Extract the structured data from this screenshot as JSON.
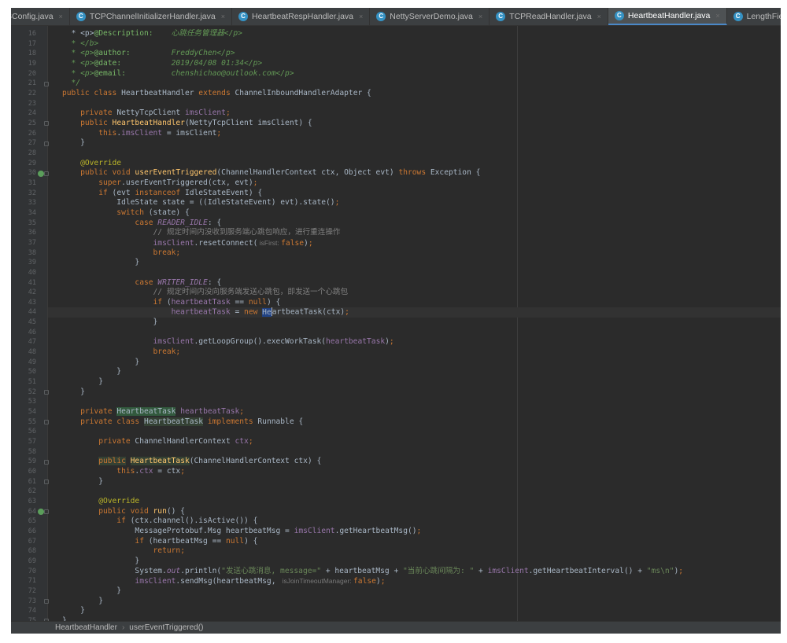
{
  "tabs": [
    {
      "label": "SConfig.java",
      "active": false,
      "icon": "none"
    },
    {
      "label": "TCPChannelInitializerHandler.java",
      "active": false,
      "icon": "class-icon"
    },
    {
      "label": "HeartbeatRespHandler.java",
      "active": false,
      "icon": "class-icon"
    },
    {
      "label": "NettyServerDemo.java",
      "active": false,
      "icon": "class-icon"
    },
    {
      "label": "TCPReadHandler.java",
      "active": false,
      "icon": "class-icon"
    },
    {
      "label": "HeartbeatHandler.java",
      "active": true,
      "icon": "class-icon"
    },
    {
      "label": "LengthFieldBasedFrameD",
      "active": false,
      "icon": "class-icon"
    }
  ],
  "class_icon_glyph": "C",
  "close_glyph": "×",
  "code_lines": [
    {
      "n": "16",
      "segs": [
        [
          "  ",
          ""
        ],
        [
          "* <p>",
          ""
        ],
        [
          "@Description:",
          "dt"
        ],
        [
          "    心跳任务管理器</p>",
          "cd"
        ]
      ],
      "cls": "cd"
    },
    {
      "n": "17",
      "segs": [
        [
          "  * </b>",
          "cd"
        ]
      ]
    },
    {
      "n": "18",
      "segs": [
        [
          "  * <p>",
          "cd"
        ],
        [
          "@author:",
          "dt"
        ],
        [
          "         FreddyChen</p>",
          "cd"
        ]
      ]
    },
    {
      "n": "19",
      "segs": [
        [
          "  * <p>",
          "cd"
        ],
        [
          "@date:",
          "dt"
        ],
        [
          "           2019/04/08 01:34</p>",
          "cd"
        ]
      ]
    },
    {
      "n": "20",
      "segs": [
        [
          "  * <p>",
          "cd"
        ],
        [
          "@email:",
          "dt"
        ],
        [
          "          chenshichao@outlook.com</p>",
          "cd"
        ]
      ]
    },
    {
      "n": "21",
      "segs": [
        [
          "  */",
          "cd"
        ]
      ]
    },
    {
      "n": "22",
      "segs": [
        [
          "public class ",
          "k"
        ],
        [
          "HeartbeatHandler ",
          ""
        ],
        [
          "extends ",
          "k"
        ],
        [
          "ChannelInboundHandlerAdapter {",
          ""
        ]
      ]
    },
    {
      "n": "23",
      "segs": []
    },
    {
      "n": "24",
      "segs": [
        [
          "    private ",
          "k"
        ],
        [
          "NettyTcpClient ",
          ""
        ],
        [
          "imsClient",
          "f"
        ],
        [
          ";",
          "k"
        ]
      ]
    },
    {
      "n": "25",
      "segs": [
        [
          "    public ",
          "k"
        ],
        [
          "HeartbeatHandler",
          "m"
        ],
        [
          "(NettyTcpClient imsClient) {",
          ""
        ]
      ]
    },
    {
      "n": "26",
      "segs": [
        [
          "        this",
          "k"
        ],
        [
          ".",
          ""
        ],
        [
          "imsClient",
          "f"
        ],
        [
          " = imsClient",
          ""
        ],
        [
          ";",
          "k"
        ]
      ]
    },
    {
      "n": "27",
      "segs": [
        [
          "    }",
          ""
        ]
      ]
    },
    {
      "n": "28",
      "segs": []
    },
    {
      "n": "29",
      "segs": [
        [
          "    @Override",
          "a"
        ]
      ]
    },
    {
      "n": "30",
      "segs": [
        [
          "    public void ",
          "k"
        ],
        [
          "userEventTriggered",
          "m"
        ],
        [
          "(ChannelHandlerContext ctx, Object evt) ",
          ""
        ],
        [
          "throws ",
          "k"
        ],
        [
          "Exception {",
          ""
        ]
      ]
    },
    {
      "n": "31",
      "segs": [
        [
          "        super",
          "k"
        ],
        [
          ".userEventTriggered(ctx, evt)",
          ""
        ],
        [
          ";",
          "k"
        ]
      ]
    },
    {
      "n": "32",
      "segs": [
        [
          "        if ",
          "k"
        ],
        [
          "(evt ",
          ""
        ],
        [
          "instanceof ",
          "k"
        ],
        [
          "IdleStateEvent) {",
          ""
        ]
      ]
    },
    {
      "n": "33",
      "segs": [
        [
          "            IdleState state = ((IdleStateEvent) evt).state()",
          ""
        ],
        [
          ";",
          "k"
        ]
      ]
    },
    {
      "n": "34",
      "segs": [
        [
          "            switch ",
          "k"
        ],
        [
          "(state) {",
          ""
        ]
      ]
    },
    {
      "n": "35",
      "segs": [
        [
          "                case ",
          "k"
        ],
        [
          "READER_IDLE",
          "fi"
        ],
        [
          ": {",
          ""
        ]
      ]
    },
    {
      "n": "36",
      "segs": [
        [
          "                    // 规定时间内没收到服务端心跳包响应，进行重连操作",
          "c"
        ]
      ]
    },
    {
      "n": "37",
      "segs": [
        [
          "                    ",
          ""
        ],
        [
          "imsClient",
          "f"
        ],
        [
          ".resetConnect(",
          ""
        ],
        [
          " isFirst: ",
          "hint"
        ],
        [
          "false",
          "k"
        ],
        [
          ")",
          ""
        ],
        [
          ";",
          "k"
        ]
      ]
    },
    {
      "n": "38",
      "segs": [
        [
          "                    break",
          "k"
        ],
        [
          ";",
          "k"
        ]
      ]
    },
    {
      "n": "39",
      "segs": [
        [
          "                }",
          ""
        ]
      ]
    },
    {
      "n": "40",
      "segs": []
    },
    {
      "n": "41",
      "segs": [
        [
          "                case ",
          "k"
        ],
        [
          "WRITER_IDLE",
          "fi"
        ],
        [
          ": {",
          ""
        ]
      ]
    },
    {
      "n": "42",
      "segs": [
        [
          "                    // 规定时间内没向服务端发送心跳包，即发送一个心跳包",
          "c"
        ]
      ]
    },
    {
      "n": "43",
      "segs": [
        [
          "                    if ",
          "k"
        ],
        [
          "(",
          ""
        ],
        [
          "heartbeatTask",
          "f"
        ],
        [
          " == ",
          ""
        ],
        [
          "null",
          "k"
        ],
        [
          ") {",
          ""
        ]
      ]
    },
    {
      "n": "44",
      "segs": [
        [
          "                        ",
          ""
        ],
        [
          "heartbeatTask",
          "f"
        ],
        [
          " = ",
          ""
        ],
        [
          "new ",
          "k"
        ],
        [
          "He",
          "sel"
        ],
        [
          "|",
          "cursor"
        ],
        [
          "artbeatTask(ctx)",
          ""
        ],
        [
          ";",
          "k"
        ]
      ]
    },
    {
      "n": "45",
      "segs": [
        [
          "                    }",
          ""
        ]
      ]
    },
    {
      "n": "46",
      "segs": []
    },
    {
      "n": "47",
      "segs": [
        [
          "                    ",
          ""
        ],
        [
          "imsClient",
          "f"
        ],
        [
          ".getLoopGroup().execWorkTask(",
          ""
        ],
        [
          "heartbeatTask",
          "f"
        ],
        [
          ")",
          ""
        ],
        [
          ";",
          "k"
        ]
      ]
    },
    {
      "n": "48",
      "segs": [
        [
          "                    break",
          "k"
        ],
        [
          ";",
          "k"
        ]
      ]
    },
    {
      "n": "49",
      "segs": [
        [
          "                }",
          ""
        ]
      ]
    },
    {
      "n": "50",
      "segs": [
        [
          "            }",
          ""
        ]
      ]
    },
    {
      "n": "51",
      "segs": [
        [
          "        }",
          ""
        ]
      ]
    },
    {
      "n": "52",
      "segs": [
        [
          "    }",
          ""
        ]
      ]
    },
    {
      "n": "53",
      "segs": []
    },
    {
      "n": "54",
      "segs": [
        [
          "    private ",
          "k"
        ],
        [
          "HeartbeatTask",
          "hl2"
        ],
        [
          " ",
          ""
        ],
        [
          "heartbeatTask",
          "f"
        ],
        [
          ";",
          "k"
        ]
      ]
    },
    {
      "n": "55",
      "segs": [
        [
          "    private class ",
          "k"
        ],
        [
          "HeartbeatTask",
          "hl"
        ],
        [
          " ",
          ""
        ],
        [
          "implements ",
          "k"
        ],
        [
          "Runnable {",
          ""
        ]
      ]
    },
    {
      "n": "56",
      "segs": []
    },
    {
      "n": "57",
      "segs": [
        [
          "        private ",
          "k"
        ],
        [
          "ChannelHandlerContext ",
          ""
        ],
        [
          "ctx",
          "f"
        ],
        [
          ";",
          "k"
        ]
      ]
    },
    {
      "n": "58",
      "segs": []
    },
    {
      "n": "59",
      "segs": [
        [
          "        ",
          ""
        ],
        [
          "public",
          "hlk"
        ],
        [
          " ",
          ""
        ],
        [
          "HeartbeatTask",
          "hlm"
        ],
        [
          "(ChannelHandlerContext ctx) {",
          ""
        ]
      ]
    },
    {
      "n": "60",
      "segs": [
        [
          "            this",
          "k"
        ],
        [
          ".",
          ""
        ],
        [
          "ctx",
          "f"
        ],
        [
          " = ctx",
          ""
        ],
        [
          ";",
          "k"
        ]
      ]
    },
    {
      "n": "61",
      "segs": [
        [
          "        }",
          ""
        ]
      ]
    },
    {
      "n": "62",
      "segs": []
    },
    {
      "n": "63",
      "segs": [
        [
          "        @Override",
          "a"
        ]
      ]
    },
    {
      "n": "64",
      "segs": [
        [
          "        public void ",
          "k"
        ],
        [
          "run",
          "m"
        ],
        [
          "() {",
          ""
        ]
      ]
    },
    {
      "n": "65",
      "segs": [
        [
          "            if ",
          "k"
        ],
        [
          "(ctx.channel().isActive()) {",
          ""
        ]
      ]
    },
    {
      "n": "66",
      "segs": [
        [
          "                MessageProtobuf.Msg heartbeatMsg = ",
          ""
        ],
        [
          "imsClient",
          "f"
        ],
        [
          ".getHeartbeatMsg()",
          ""
        ],
        [
          ";",
          "k"
        ]
      ]
    },
    {
      "n": "67",
      "segs": [
        [
          "                if ",
          "k"
        ],
        [
          "(heartbeatMsg == ",
          ""
        ],
        [
          "null",
          "k"
        ],
        [
          ") {",
          ""
        ]
      ]
    },
    {
      "n": "68",
      "segs": [
        [
          "                    return",
          "k"
        ],
        [
          ";",
          "k"
        ]
      ]
    },
    {
      "n": "69",
      "segs": [
        [
          "                }",
          ""
        ]
      ]
    },
    {
      "n": "70",
      "segs": [
        [
          "                System.",
          ""
        ],
        [
          "out",
          "fi"
        ],
        [
          ".println(",
          ""
        ],
        [
          "\"发送心跳消息, message=\"",
          "s"
        ],
        [
          " + heartbeatMsg + ",
          ""
        ],
        [
          "\"当前心跳间隔为: \"",
          "s"
        ],
        [
          " + ",
          ""
        ],
        [
          "imsClient",
          "f"
        ],
        [
          ".getHeartbeatInterval() + ",
          ""
        ],
        [
          "\"ms\\n\"",
          "s"
        ],
        [
          ")",
          ""
        ],
        [
          ";",
          "k"
        ]
      ]
    },
    {
      "n": "71",
      "segs": [
        [
          "                ",
          ""
        ],
        [
          "imsClient",
          "f"
        ],
        [
          ".sendMsg(heartbeatMsg, ",
          ""
        ],
        [
          " isJoinTimeoutManager: ",
          "hint"
        ],
        [
          "false",
          "k"
        ],
        [
          ")",
          ""
        ],
        [
          ";",
          "k"
        ]
      ]
    },
    {
      "n": "72",
      "segs": [
        [
          "            }",
          ""
        ]
      ]
    },
    {
      "n": "73",
      "segs": [
        [
          "        }",
          ""
        ]
      ]
    },
    {
      "n": "74",
      "segs": [
        [
          "    }",
          ""
        ]
      ]
    },
    {
      "n": "75",
      "segs": [
        [
          "}",
          ""
        ]
      ]
    }
  ],
  "breadcrumbs": {
    "class_name": "HeartbeatHandler",
    "separator": "›",
    "method_name": "userEventTriggered()"
  },
  "colors": {
    "background": "#2b2b2b",
    "keyword": "#cc7832",
    "field": "#9876aa",
    "method": "#ffc66d",
    "annotation": "#bbb529",
    "string": "#6a8759",
    "comment": "#808080",
    "doc_comment": "#629755",
    "default_text": "#a9b7c6"
  }
}
